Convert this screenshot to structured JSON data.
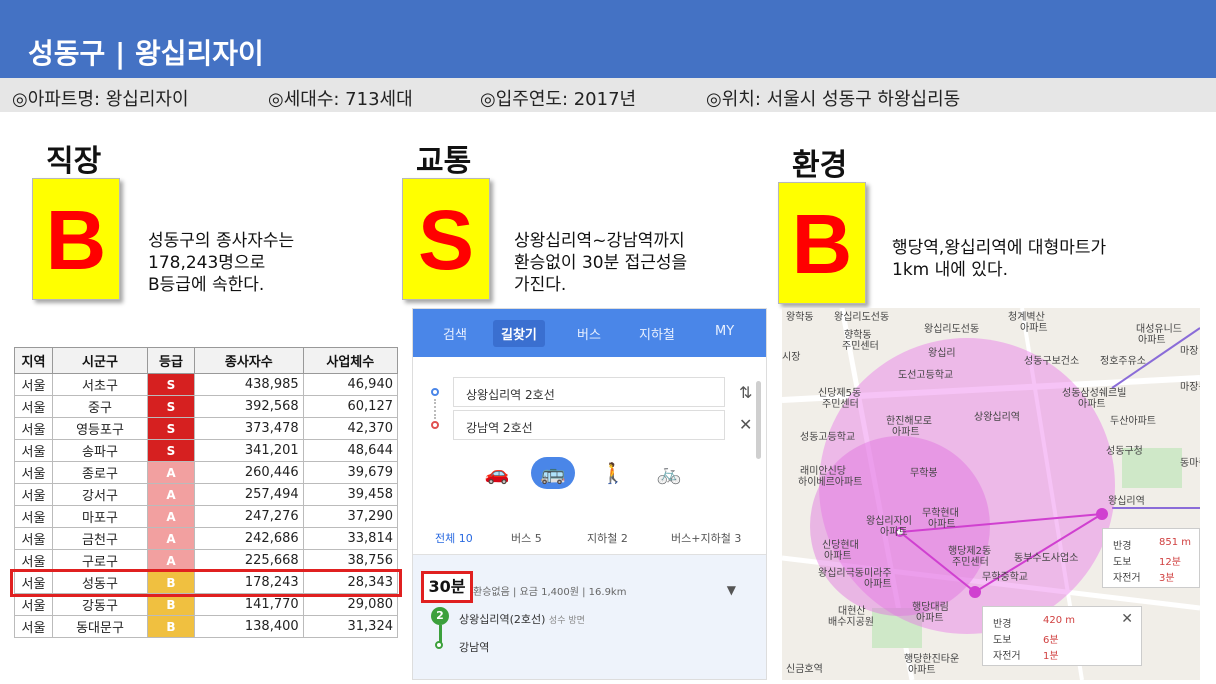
{
  "header": {
    "title": "성동구 | 왕십리자이"
  },
  "info": {
    "apt": "◎아파트명: 왕십리자이",
    "units": "◎세대수: 713세대",
    "year": "◎입주연도: 2017년",
    "location": "◎위치: 서울시 성동구 하왕십리동"
  },
  "sections": {
    "job": {
      "title": "직장",
      "grade": "B",
      "desc1": "성동구의 종사자수는",
      "desc2": "178,243명으로",
      "desc3": "B등급에 속한다."
    },
    "transit": {
      "title": "교통",
      "grade": "S",
      "desc1": "상왕십리역~강남역까지",
      "desc2": "환승없이 30분 접근성을",
      "desc3": "가진다."
    },
    "environment": {
      "title": "환경",
      "grade": "B",
      "desc1": "행당역,왕십리역에 대형마트가",
      "desc2": "1km 내에 있다."
    }
  },
  "table": {
    "headers": [
      "지역",
      "시군구",
      "등급",
      "종사자수",
      "사업체수"
    ],
    "rows": [
      {
        "region": "서울",
        "district": "서초구",
        "grade": "S",
        "workers": "438,985",
        "firms": "46,940"
      },
      {
        "region": "서울",
        "district": "중구",
        "grade": "S",
        "workers": "392,568",
        "firms": "60,127"
      },
      {
        "region": "서울",
        "district": "영등포구",
        "grade": "S",
        "workers": "373,478",
        "firms": "42,370"
      },
      {
        "region": "서울",
        "district": "송파구",
        "grade": "S",
        "workers": "341,201",
        "firms": "48,644"
      },
      {
        "region": "서울",
        "district": "종로구",
        "grade": "A",
        "workers": "260,446",
        "firms": "39,679"
      },
      {
        "region": "서울",
        "district": "강서구",
        "grade": "A",
        "workers": "257,494",
        "firms": "39,458"
      },
      {
        "region": "서울",
        "district": "마포구",
        "grade": "A",
        "workers": "247,276",
        "firms": "37,290"
      },
      {
        "region": "서울",
        "district": "금천구",
        "grade": "A",
        "workers": "242,686",
        "firms": "33,814"
      },
      {
        "region": "서울",
        "district": "구로구",
        "grade": "A",
        "workers": "225,668",
        "firms": "38,756"
      },
      {
        "region": "서울",
        "district": "성동구",
        "grade": "B",
        "workers": "178,243",
        "firms": "28,343"
      },
      {
        "region": "서울",
        "district": "강동구",
        "grade": "B",
        "workers": "141,770",
        "firms": "29,080"
      },
      {
        "region": "서울",
        "district": "동대문구",
        "grade": "B",
        "workers": "138,400",
        "firms": "31,324"
      }
    ]
  },
  "route_app": {
    "tabs": [
      "검색",
      "길찾기",
      "버스",
      "지하철",
      "MY"
    ],
    "from": "상왕십리역 2호선",
    "to": "강남역 2호선",
    "subtabs": [
      "전체 10",
      "버스 5",
      "지하철 2",
      "버스+지하철 3"
    ],
    "time": "30분",
    "meta": "환승없음 | 요금 1,400원 | 16.9km",
    "start_station": "상왕십리역(2호선)",
    "start_dir": "성수 방면",
    "line_badge": "2",
    "end_station": "강남역"
  },
  "map": {
    "places": [
      "왕학동",
      "왕십리도선동",
      "청계벽산",
      "아파트",
      "향학동",
      "주민센터",
      "왕십리도선동",
      "왕십리",
      "시장",
      "성동구보건소",
      "정호주유소",
      "대성유니드",
      "아파트",
      "마장",
      "도선고등학교",
      "성동삼성쉐르빌",
      "아파트",
      "마장동",
      "신당제5동",
      "주민센터",
      "한진해모로",
      "아파트",
      "상왕십리역",
      "두산아파트",
      "성동고등학교",
      "성동구청",
      "동마중학",
      "래미안신당",
      "하이베르아파트",
      "무학봉",
      "왕십리자이",
      "아파트",
      "왕십리역",
      "무학현대",
      "아파트",
      "신당현대",
      "아파트",
      "왕십리극동미라주",
      "아파트",
      "행당제2동",
      "주민센터",
      "동부수도사업소",
      "무학중학교",
      "대현산",
      "배수지공원",
      "행당대림",
      "아파트",
      "행당한진타운",
      "아파트",
      "신금호역"
    ],
    "card1": {
      "labels": [
        "반경",
        "도보",
        "자전거"
      ],
      "values": [
        "851 m",
        "12분",
        "3분"
      ]
    },
    "card2": {
      "labels": [
        "반경",
        "도보",
        "자전거"
      ],
      "values": [
        "420 m",
        "6분",
        "1분"
      ]
    }
  },
  "colors": {
    "header": "#4472c4",
    "grade_bg": "#ffff00",
    "grade_fg": "#ff0000",
    "highlight": "#e02020",
    "radius": "#e890e8"
  }
}
